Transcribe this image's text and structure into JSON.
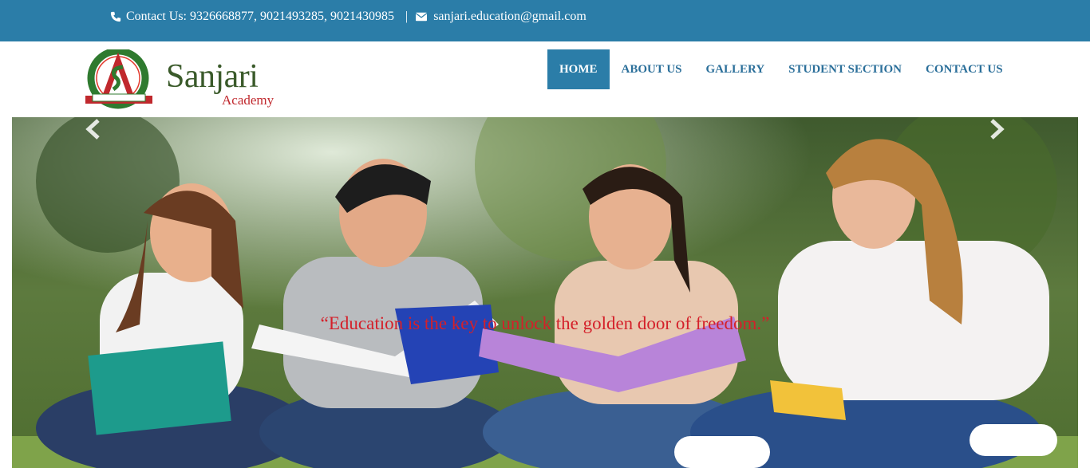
{
  "topbar": {
    "contact_text": "Contact Us: 9326668877, 9021493285, 9021430985",
    "separator": "|",
    "email": "sanjari.education@gmail.com",
    "phone_icon": "phone-icon",
    "mail_icon": "envelope-icon"
  },
  "brand": {
    "name": "Sanjari",
    "sub": "Academy",
    "emblem_ring_text": "INSPIRE · EDUCATE · TRANSFORM",
    "emblem_banner": "Sanjari Academy",
    "emblem_since": "Since 2013"
  },
  "nav": {
    "items": [
      {
        "label": "HOME",
        "active": true
      },
      {
        "label": "ABOUT US",
        "active": false
      },
      {
        "label": "GALLERY",
        "active": false
      },
      {
        "label": "STUDENT SECTION",
        "active": false
      },
      {
        "label": "CONTACT US",
        "active": false
      }
    ]
  },
  "hero": {
    "caption": "“Education is the key to unlock the golden door of freedom.”",
    "prev_icon": "chevron-left-icon",
    "next_icon": "chevron-right-icon"
  },
  "colors": {
    "topbar": "#2b7da8",
    "nav_text": "#2b6f9a",
    "caption": "#d4202a",
    "brand_green": "#3a5a2a",
    "brand_red": "#c0282d"
  }
}
